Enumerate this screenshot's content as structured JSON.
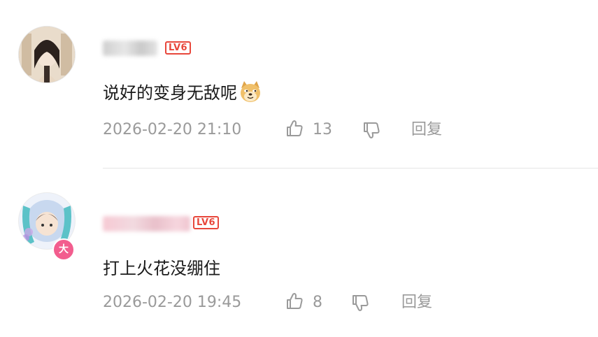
{
  "comments": [
    {
      "level": "LV6",
      "text": "说好的变身无敌呢",
      "emoji": "doge-emoji",
      "timestamp": "2026-02-20 21:10",
      "likes": "13",
      "reply_label": "回复"
    },
    {
      "level": "LV6",
      "text": "打上火花没绷住",
      "timestamp": "2026-02-20 19:45",
      "likes": "8",
      "reply_label": "回复",
      "vip_badge": "大"
    }
  ],
  "colors": {
    "level_badge": "#e8473b",
    "meta_text": "#9a9a9a",
    "vip_badge": "#f25d8e"
  }
}
